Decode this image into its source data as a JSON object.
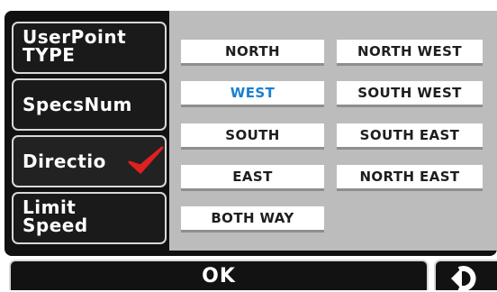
{
  "sidebar": {
    "items": [
      {
        "lines": [
          "UserPoint",
          "TYPE"
        ],
        "selected": false
      },
      {
        "lines": [
          "SpecsNum"
        ],
        "selected": false
      },
      {
        "lines": [
          "Directio"
        ],
        "selected": true,
        "checked": true
      },
      {
        "lines": [
          "Limit",
          "Speed"
        ],
        "selected": false
      }
    ]
  },
  "options": {
    "north": "NORTH",
    "north_west": "NORTH WEST",
    "west": "WEST",
    "south_west": "SOUTH WEST",
    "south": "SOUTH",
    "south_east": "SOUTH EAST",
    "east": "EAST",
    "north_east": "NORTH EAST",
    "both_way": "BOTH WAY",
    "selected": "WEST"
  },
  "footer": {
    "ok_label": "OK"
  },
  "icons": {
    "check": "check-icon",
    "back": "back-arrow-icon"
  },
  "colors": {
    "selected_text": "#1a7fd0",
    "check": "#e02020",
    "panel_bg": "#bcbcbc",
    "button_bg": "#1a1a1a"
  }
}
